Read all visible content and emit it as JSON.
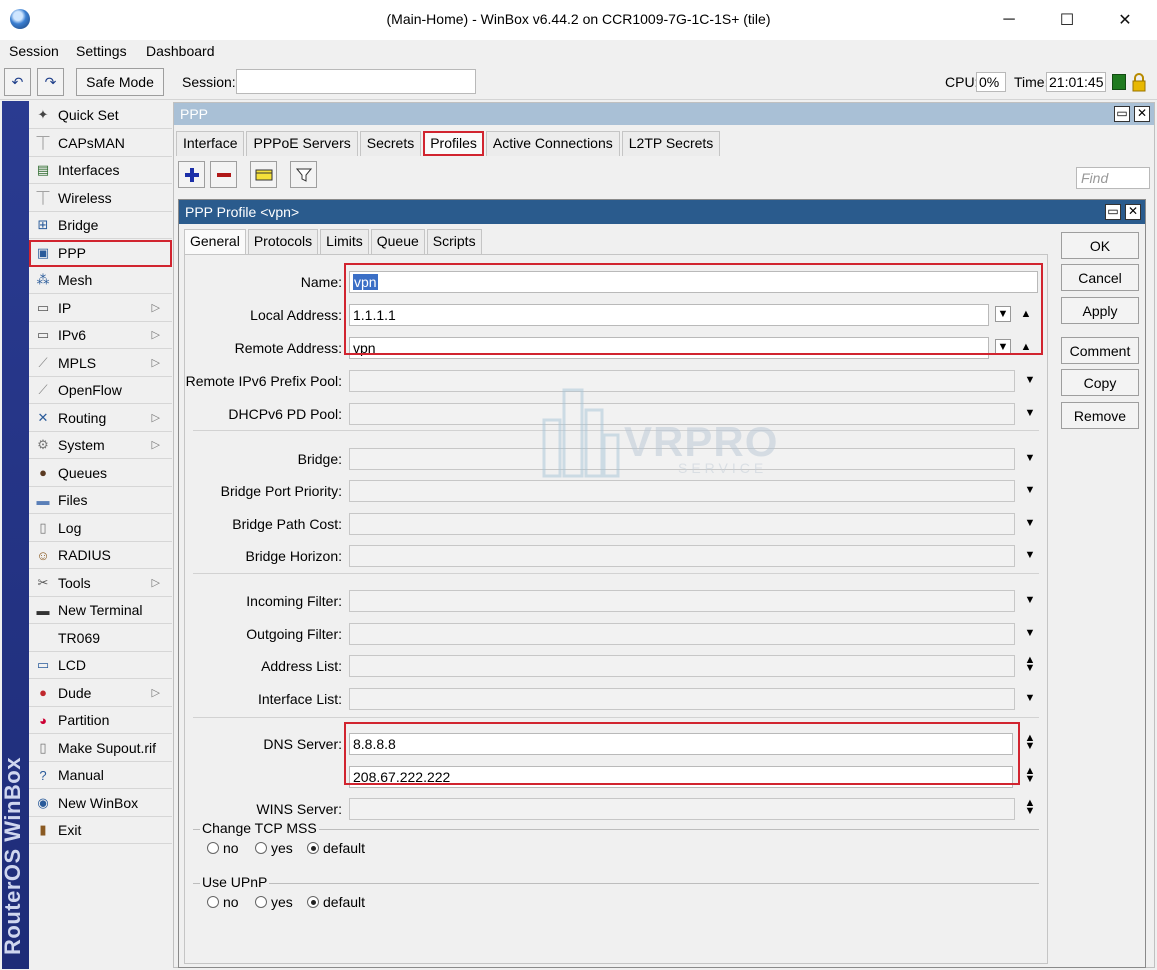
{
  "window": {
    "title": "(Main-Home) - WinBox v6.44.2 on CCR1009-7G-1C-1S+ (tile)",
    "minimize": "─",
    "maximize": "☐",
    "close": "✕"
  },
  "menu": [
    "Session",
    "Settings",
    "Dashboard"
  ],
  "toolbar": {
    "undo": "↶",
    "redo": "↷",
    "safe_mode": "Safe Mode",
    "session_label": "Session:",
    "session_value": "",
    "cpu_label": "CPU:",
    "cpu_value": "0%",
    "time_label": "Time:",
    "time_value": "21:01:45"
  },
  "brand": "RouterOS WinBox",
  "sidebar": [
    {
      "label": "Quick Set",
      "icon": "wand-icon",
      "glyph": "✦",
      "arrow": false
    },
    {
      "label": "CAPsMAN",
      "icon": "antenna-icon",
      "glyph": "⏉",
      "arrow": false
    },
    {
      "label": "Interfaces",
      "icon": "interfaces-icon",
      "glyph": "▤",
      "arrow": false
    },
    {
      "label": "Wireless",
      "icon": "antenna-icon",
      "glyph": "⏉",
      "arrow": false
    },
    {
      "label": "Bridge",
      "icon": "bridge-icon",
      "glyph": "⊞",
      "arrow": false
    },
    {
      "label": "PPP",
      "icon": "ppp-icon",
      "glyph": "▣",
      "arrow": false
    },
    {
      "label": "Mesh",
      "icon": "mesh-icon",
      "glyph": "⁂",
      "arrow": false
    },
    {
      "label": "IP",
      "icon": "ip-icon",
      "glyph": "▭",
      "arrow": true
    },
    {
      "label": "IPv6",
      "icon": "ipv6-icon",
      "glyph": "▭",
      "arrow": true
    },
    {
      "label": "MPLS",
      "icon": "mpls-icon",
      "glyph": "⟋",
      "arrow": true
    },
    {
      "label": "OpenFlow",
      "icon": "openflow-icon",
      "glyph": "⟋",
      "arrow": false
    },
    {
      "label": "Routing",
      "icon": "routing-icon",
      "glyph": "✕",
      "arrow": true
    },
    {
      "label": "System",
      "icon": "gear-icon",
      "glyph": "⚙",
      "arrow": true
    },
    {
      "label": "Queues",
      "icon": "queues-icon",
      "glyph": "●",
      "arrow": false
    },
    {
      "label": "Files",
      "icon": "folder-icon",
      "glyph": "▬",
      "arrow": false
    },
    {
      "label": "Log",
      "icon": "log-icon",
      "glyph": "▯",
      "arrow": false
    },
    {
      "label": "RADIUS",
      "icon": "radius-icon",
      "glyph": "☺",
      "arrow": false
    },
    {
      "label": "Tools",
      "icon": "tools-icon",
      "glyph": "✂",
      "arrow": true
    },
    {
      "label": "New Terminal",
      "icon": "terminal-icon",
      "glyph": "▬",
      "arrow": false
    },
    {
      "label": "TR069",
      "icon": "",
      "glyph": "",
      "arrow": false
    },
    {
      "label": "LCD",
      "icon": "lcd-icon",
      "glyph": "▭",
      "arrow": false
    },
    {
      "label": "Dude",
      "icon": "dude-icon",
      "glyph": "●",
      "arrow": true
    },
    {
      "label": "Partition",
      "icon": "partition-icon",
      "glyph": "◕",
      "arrow": false
    },
    {
      "label": "Make Supout.rif",
      "icon": "document-icon",
      "glyph": "▯",
      "arrow": false
    },
    {
      "label": "Manual",
      "icon": "help-icon",
      "glyph": "?",
      "arrow": false
    },
    {
      "label": "New WinBox",
      "icon": "winbox-icon",
      "glyph": "◉",
      "arrow": false
    },
    {
      "label": "Exit",
      "icon": "exit-icon",
      "glyph": "▮",
      "arrow": false
    }
  ],
  "ppp": {
    "title": "PPP",
    "tabs": [
      "Interface",
      "PPPoE Servers",
      "Secrets",
      "Profiles",
      "Active Connections",
      "L2TP Secrets"
    ],
    "active_tab": "Profiles",
    "find_placeholder": "Find"
  },
  "profile": {
    "title": "PPP Profile <vpn>",
    "tabs": [
      "General",
      "Protocols",
      "Limits",
      "Queue",
      "Scripts"
    ],
    "active_tab": "General",
    "fields": {
      "name": {
        "label": "Name:",
        "value": "vpn"
      },
      "local_address": {
        "label": "Local Address:",
        "value": "1.1.1.1"
      },
      "remote_address": {
        "label": "Remote Address:",
        "value": "vpn"
      },
      "remote_ipv6_prefix_pool": {
        "label": "Remote IPv6 Prefix Pool:",
        "value": ""
      },
      "dhcpv6_pd_pool": {
        "label": "DHCPv6 PD Pool:",
        "value": ""
      },
      "bridge": {
        "label": "Bridge:",
        "value": ""
      },
      "bridge_port_priority": {
        "label": "Bridge Port Priority:",
        "value": ""
      },
      "bridge_path_cost": {
        "label": "Bridge Path Cost:",
        "value": ""
      },
      "bridge_horizon": {
        "label": "Bridge Horizon:",
        "value": ""
      },
      "incoming_filter": {
        "label": "Incoming Filter:",
        "value": ""
      },
      "outgoing_filter": {
        "label": "Outgoing Filter:",
        "value": ""
      },
      "address_list": {
        "label": "Address List:",
        "value": ""
      },
      "interface_list": {
        "label": "Interface List:",
        "value": ""
      },
      "dns_server": {
        "label": "DNS Server:",
        "values": [
          "8.8.8.8",
          "208.67.222.222"
        ]
      },
      "wins_server": {
        "label": "WINS Server:",
        "value": ""
      }
    },
    "change_tcp_mss": {
      "label": "Change TCP MSS",
      "options": [
        "no",
        "yes",
        "default"
      ],
      "selected": "default"
    },
    "use_upnp": {
      "label": "Use UPnP",
      "options": [
        "no",
        "yes",
        "default"
      ],
      "selected": "default"
    },
    "buttons": [
      "OK",
      "Cancel",
      "Apply",
      "Comment",
      "Copy",
      "Remove"
    ]
  },
  "watermark": {
    "main": "VRPRO",
    "sub": "SERVICE"
  },
  "colors": {
    "highlight": "#d1242f",
    "dialog_title": "#2a5b8d",
    "brand_strip": "#2a3b91"
  }
}
